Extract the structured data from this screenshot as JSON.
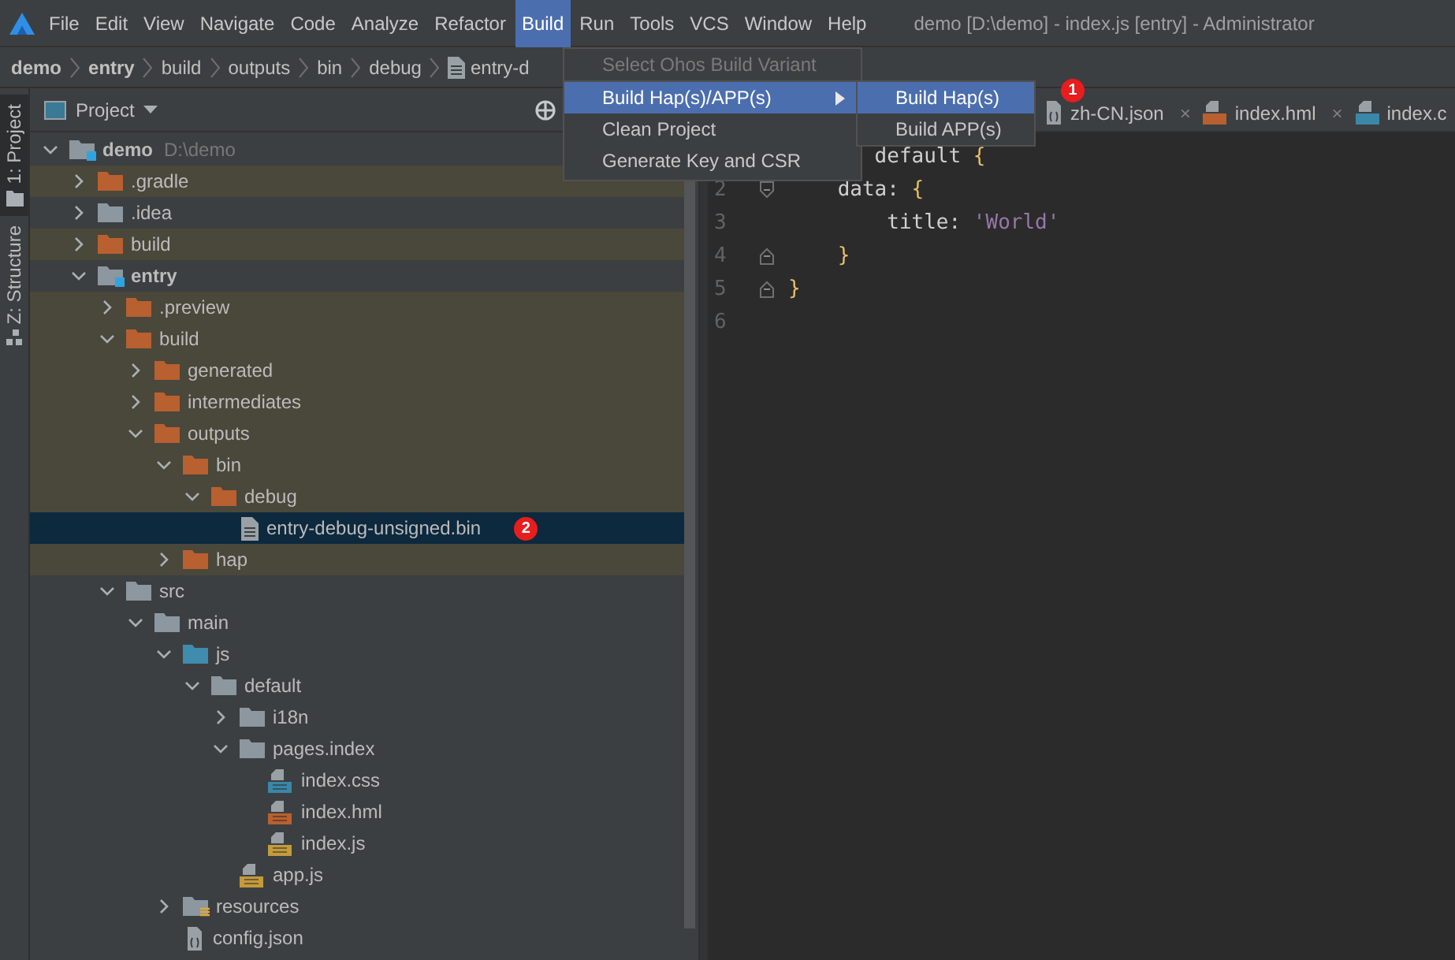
{
  "menu_bar": {
    "items": [
      {
        "label": "File",
        "selected": false
      },
      {
        "label": "Edit",
        "selected": false
      },
      {
        "label": "View",
        "selected": false
      },
      {
        "label": "Navigate",
        "selected": false
      },
      {
        "label": "Code",
        "selected": false
      },
      {
        "label": "Analyze",
        "selected": false
      },
      {
        "label": "Refactor",
        "selected": false
      },
      {
        "label": "Build",
        "selected": true
      },
      {
        "label": "Run",
        "selected": false
      },
      {
        "label": "Tools",
        "selected": false
      },
      {
        "label": "VCS",
        "selected": false
      },
      {
        "label": "Window",
        "selected": false
      },
      {
        "label": "Help",
        "selected": false
      }
    ],
    "title": "demo [D:\\demo] - index.js [entry] - Administrator"
  },
  "breadcrumb": [
    {
      "label": "demo",
      "kind": "module"
    },
    {
      "label": "entry",
      "kind": "module"
    },
    {
      "label": "build",
      "kind": "folder"
    },
    {
      "label": "outputs",
      "kind": "folder"
    },
    {
      "label": "bin",
      "kind": "folder"
    },
    {
      "label": "debug",
      "kind": "folder"
    },
    {
      "label": "entry-d",
      "kind": "file"
    }
  ],
  "tool_strip": [
    {
      "label": "1: Project",
      "kind": "project",
      "selected": true
    },
    {
      "label": "Z: Structure",
      "kind": "structure",
      "selected": false
    }
  ],
  "project": {
    "title": "Project",
    "tree": [
      {
        "name": "demo",
        "kind": "module",
        "detail": "D:\\demo",
        "expanded": true,
        "selected": false,
        "children": [
          {
            "name": ".gradle",
            "kind": "excluded",
            "expanded": false,
            "selected": false
          },
          {
            "name": ".idea",
            "kind": "folder",
            "expanded": false,
            "selected": false
          },
          {
            "name": "build",
            "kind": "excluded",
            "expanded": false,
            "selected": false
          },
          {
            "name": "entry",
            "kind": "module",
            "expanded": true,
            "selected": false,
            "children": [
              {
                "name": ".preview",
                "kind": "excluded",
                "expanded": false,
                "selected": false
              },
              {
                "name": "build",
                "kind": "excluded",
                "expanded": true,
                "selected": false,
                "children": [
                  {
                    "name": "generated",
                    "kind": "excluded",
                    "expanded": false,
                    "selected": false
                  },
                  {
                    "name": "intermediates",
                    "kind": "excluded",
                    "expanded": false,
                    "selected": false
                  },
                  {
                    "name": "outputs",
                    "kind": "excluded",
                    "expanded": true,
                    "selected": false,
                    "children": [
                      {
                        "name": "bin",
                        "kind": "excluded",
                        "expanded": true,
                        "selected": false,
                        "children": [
                          {
                            "name": "debug",
                            "kind": "excluded",
                            "expanded": true,
                            "selected": false,
                            "children": [
                              {
                                "name": "entry-debug-unsigned.bin",
                                "kind": "file",
                                "selected": true,
                                "badge": "2"
                              }
                            ]
                          }
                        ]
                      },
                      {
                        "name": "hap",
                        "kind": "excluded",
                        "expanded": false,
                        "selected": false
                      }
                    ]
                  }
                ]
              },
              {
                "name": "src",
                "kind": "folder",
                "expanded": true,
                "selected": false,
                "children": [
                  {
                    "name": "main",
                    "kind": "folder",
                    "expanded": true,
                    "selected": false,
                    "children": [
                      {
                        "name": "js",
                        "kind": "source",
                        "expanded": true,
                        "selected": false,
                        "children": [
                          {
                            "name": "default",
                            "kind": "folder",
                            "expanded": true,
                            "selected": false,
                            "children": [
                              {
                                "name": "i18n",
                                "kind": "folder",
                                "expanded": false,
                                "selected": false
                              },
                              {
                                "name": "pages.index",
                                "kind": "folder",
                                "expanded": true,
                                "selected": false,
                                "children": [
                                  {
                                    "name": "index.css",
                                    "kind": "css",
                                    "selected": false
                                  },
                                  {
                                    "name": "index.hml",
                                    "kind": "hml",
                                    "selected": false
                                  },
                                  {
                                    "name": "index.js",
                                    "kind": "js",
                                    "selected": false
                                  }
                                ]
                              },
                              {
                                "name": "app.js",
                                "kind": "js",
                                "selected": false
                              }
                            ]
                          }
                        ]
                      },
                      {
                        "name": "resources",
                        "kind": "resources",
                        "expanded": false,
                        "selected": false
                      },
                      {
                        "name": "config.json",
                        "kind": "json",
                        "selected": false
                      }
                    ]
                  }
                ]
              }
            ]
          }
        ]
      }
    ]
  },
  "editor": {
    "tabs": [
      {
        "label": "zh-CN.json",
        "kind": "json",
        "close": "×",
        "selected": false
      },
      {
        "label": "index.hml",
        "kind": "hml",
        "close": "×",
        "selected": false
      },
      {
        "label": "index.c",
        "kind": "css",
        "selected": false
      }
    ],
    "lines": [
      {
        "code": [
          {
            "text": "       default ",
            "kind": "key"
          },
          {
            "text": "{",
            "kind": "brace"
          }
        ]
      },
      {
        "number": "2",
        "kind": "fold-start",
        "code": [
          {
            "text": "    data: ",
            "kind": "key"
          },
          {
            "text": "{",
            "kind": "brace"
          }
        ]
      },
      {
        "number": "3",
        "code": [
          {
            "text": "        title: ",
            "kind": "key"
          },
          {
            "text": "'World'",
            "kind": "string"
          }
        ]
      },
      {
        "number": "4",
        "kind": "fold-end",
        "code": [
          {
            "text": "    }",
            "kind": "brace"
          }
        ]
      },
      {
        "number": "5",
        "kind": "fold-end",
        "code": [
          {
            "text": "}",
            "kind": "brace"
          }
        ]
      },
      {
        "number": "6"
      }
    ]
  },
  "build_menu": {
    "items": [
      {
        "label": "Select Ohos Build Variant",
        "disabled": true,
        "selected": false
      },
      {
        "label": "Build Hap(s)/APP(s)",
        "disabled": false,
        "selected": true,
        "submenu": [
          {
            "label": "Build Hap(s)",
            "selected": true,
            "badge": "1"
          },
          {
            "label": "Build APP(s)",
            "selected": false
          }
        ]
      },
      {
        "label": "Clean Project",
        "disabled": false,
        "selected": false
      },
      {
        "label": "Generate Key and CSR",
        "disabled": false,
        "selected": false
      }
    ]
  }
}
